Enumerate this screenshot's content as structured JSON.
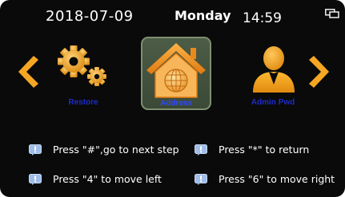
{
  "header": {
    "date": "2018-07-09",
    "day": "Monday",
    "time": "14:59"
  },
  "menu": {
    "items": [
      {
        "label": "Restore",
        "icon": "gears-icon"
      },
      {
        "label": "Address",
        "icon": "house-icon",
        "selected": true
      },
      {
        "label": "Admin Pwd",
        "icon": "user-icon"
      }
    ]
  },
  "help": [
    {
      "text": "Press \"#\",go to next step"
    },
    {
      "text": "Press \"*\" to return"
    },
    {
      "text": "Press \"4\" to move left"
    },
    {
      "text": "Press \"6\" to move right"
    }
  ],
  "colors": {
    "background": "#0a0a0a",
    "accent_orange": "#f5a623",
    "label_blue": "#2f48ff",
    "selected_tile": "#4c5c46"
  }
}
